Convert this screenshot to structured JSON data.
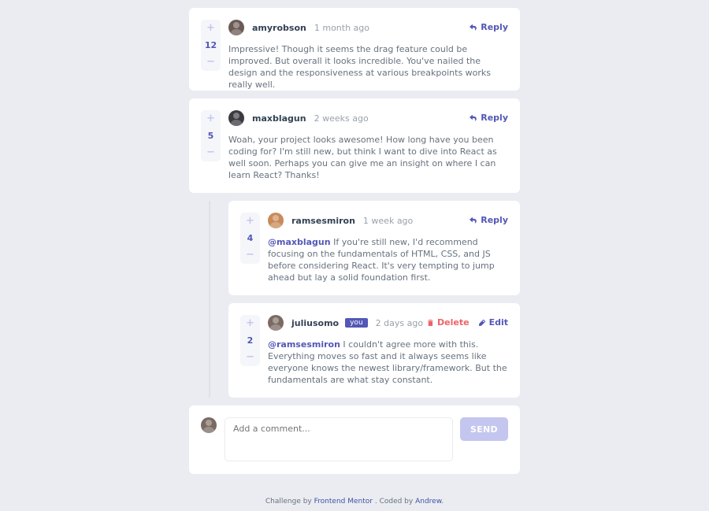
{
  "comments": [
    {
      "score": "12",
      "username": "amyrobson",
      "time": "1 month ago",
      "avatar_color": "#6b5a55",
      "content": "Impressive! Though it seems the drag feature could be improved. But overall it looks incredible. You've nailed the design and the responsiveness at various breakpoints works really well.",
      "reply_label": "Reply"
    },
    {
      "score": "5",
      "username": "maxblagun",
      "time": "2 weeks ago",
      "avatar_color": "#3b3a3f",
      "content": "Woah, your project looks awesome! How long have you been coding for? I'm still new, but think I want to dive into React as well soon. Perhaps you can give me an insight on where I can learn React? Thanks!",
      "reply_label": "Reply"
    }
  ],
  "replies": [
    {
      "score": "4",
      "username": "ramsesmiron",
      "time": "1 week ago",
      "avatar_color": "#c98a5a",
      "mention": "@maxblagun",
      "content": "If you're still new, I'd recommend focusing on the fundamentals of HTML, CSS, and JS before considering React. It's very tempting to jump ahead but lay a solid foundation first.",
      "reply_label": "Reply"
    },
    {
      "score": "2",
      "username": "juliusomo",
      "you_badge": "you",
      "time": "2 days ago",
      "avatar_color": "#7a6a62",
      "mention": "@ramsesmiron",
      "content": "I couldn't agree more with this. Everything moves so fast and it always seems like everyone knows the newest library/framework. But the fundamentals are what stay constant.",
      "delete_label": "Delete",
      "edit_label": "Edit"
    }
  ],
  "composer": {
    "placeholder": "Add a comment...",
    "send_label": "SEND",
    "avatar_color": "#7a6a62"
  },
  "attribution": {
    "prefix": "Challenge by",
    "link1": "Frontend Mentor",
    "middle": ". Coded by",
    "link2": "Andrew",
    "suffix": "."
  },
  "icons": {
    "upvote": "plus-icon",
    "downvote": "minus-icon",
    "reply": "reply-icon",
    "delete": "trash-icon",
    "edit": "pencil-icon"
  },
  "colors": {
    "primary": "#5357b6",
    "danger": "#ed6368",
    "muted_accent": "#c5c6ef",
    "background": "#eaecf1"
  }
}
